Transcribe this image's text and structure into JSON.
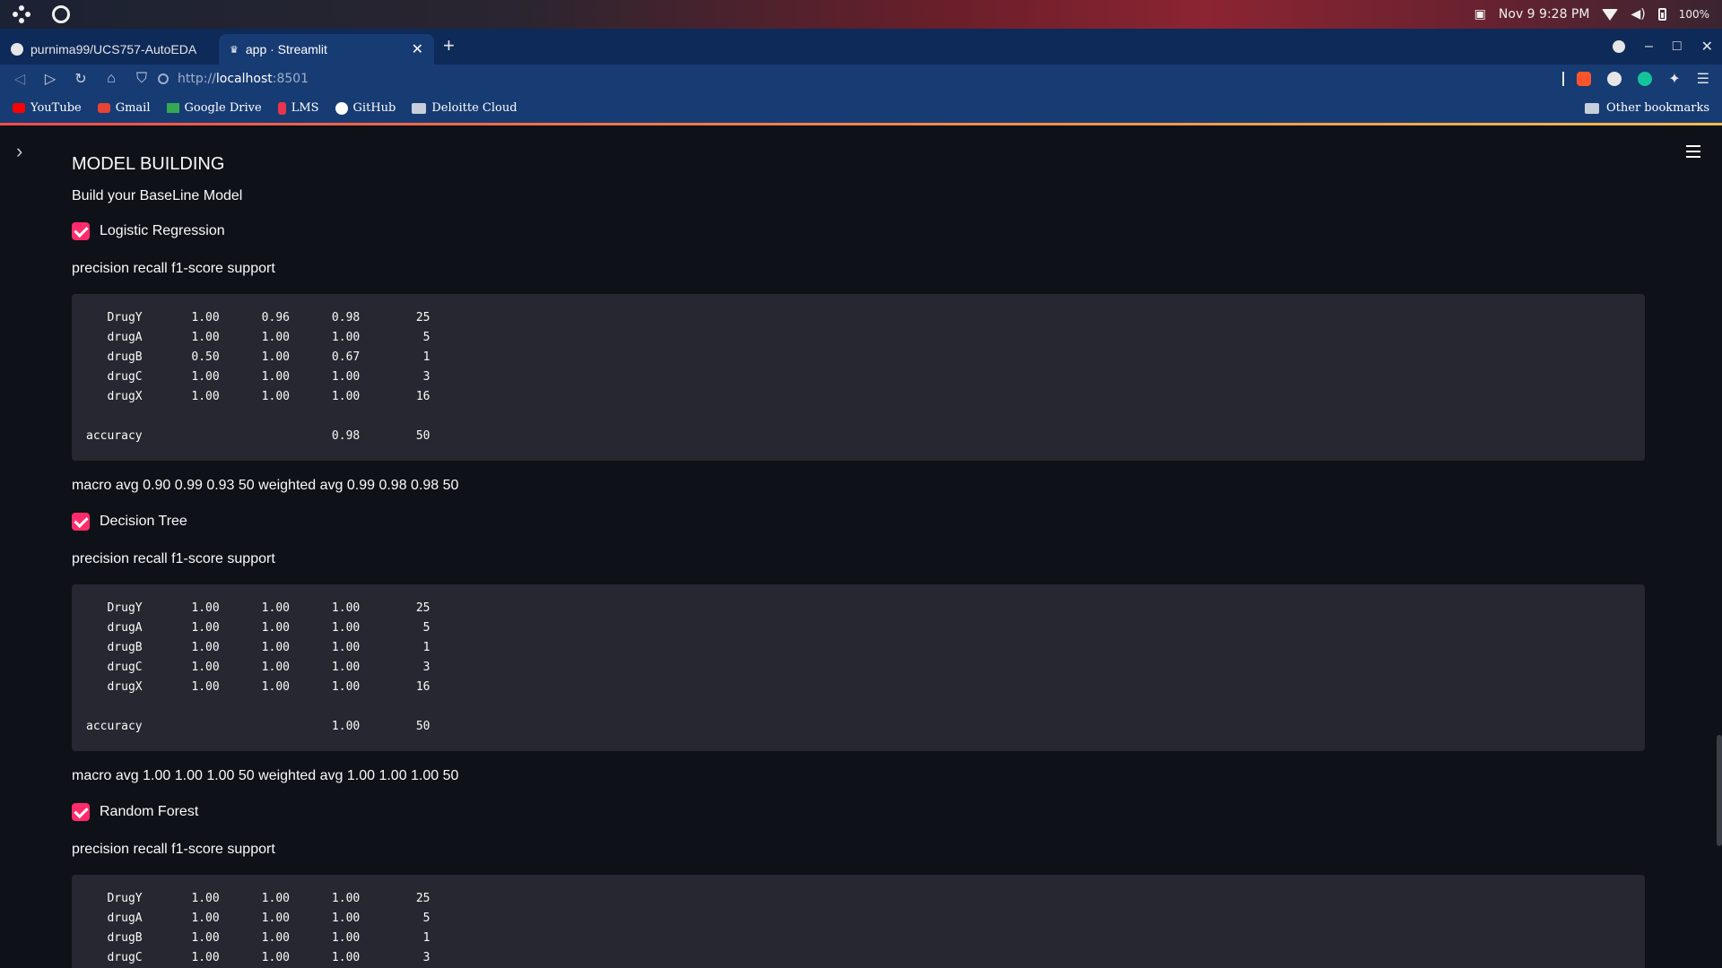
{
  "os_bar": {
    "datetime": "Nov 9  9:28 PM",
    "battery": "100%"
  },
  "tabs": [
    {
      "label": "purnima99/UCS757-AutoEDA"
    },
    {
      "label": "app · Streamlit"
    }
  ],
  "address": {
    "scheme": "http://",
    "host": "localhost",
    "port": ":8501"
  },
  "bookmarks": [
    {
      "label": "YouTube",
      "color": "#ff0000"
    },
    {
      "label": "Gmail",
      "color": "#ea4335"
    },
    {
      "label": "Google Drive",
      "color": "#34a853"
    },
    {
      "label": "LMS",
      "color": "#e8344e"
    },
    {
      "label": "GitHub",
      "color": "#ffffff"
    },
    {
      "label": "Deloitte Cloud",
      "color": "#c7cfdc"
    }
  ],
  "other_bookmarks": "Other bookmarks",
  "page": {
    "title": "MODEL BUILDING",
    "subtitle": "Build your BaseLine Model",
    "sections": [
      {
        "checkbox_label": "Logistic Regression",
        "checked": true,
        "header": "precision recall f1-score support",
        "report": "   DrugY       1.00      0.96      0.98        25\n   drugA       1.00      1.00      1.00         5\n   drugB       0.50      1.00      0.67         1\n   drugC       1.00      1.00      1.00         3\n   drugX       1.00      1.00      1.00        16\n\naccuracy                           0.98        50",
        "footer": "macro avg 0.90 0.99 0.93 50 weighted avg 0.99 0.98 0.98 50"
      },
      {
        "checkbox_label": "Decision Tree",
        "checked": true,
        "header": "precision recall f1-score support",
        "report": "   DrugY       1.00      1.00      1.00        25\n   drugA       1.00      1.00      1.00         5\n   drugB       1.00      1.00      1.00         1\n   drugC       1.00      1.00      1.00         3\n   drugX       1.00      1.00      1.00        16\n\naccuracy                           1.00        50",
        "footer": "macro avg 1.00 1.00 1.00 50 weighted avg 1.00 1.00 1.00 50"
      },
      {
        "checkbox_label": "Random Forest",
        "checked": true,
        "header": "precision recall f1-score support",
        "report": "   DrugY       1.00      1.00      1.00        25\n   drugA       1.00      1.00      1.00         5\n   drugB       1.00      1.00      1.00         1\n   drugC       1.00      1.00      1.00         3",
        "footer": ""
      }
    ]
  },
  "colors": {
    "accent": "#ff2b6b",
    "app_bg": "#0e1117",
    "code_bg": "#262730",
    "browser_bar": "#173b73"
  }
}
